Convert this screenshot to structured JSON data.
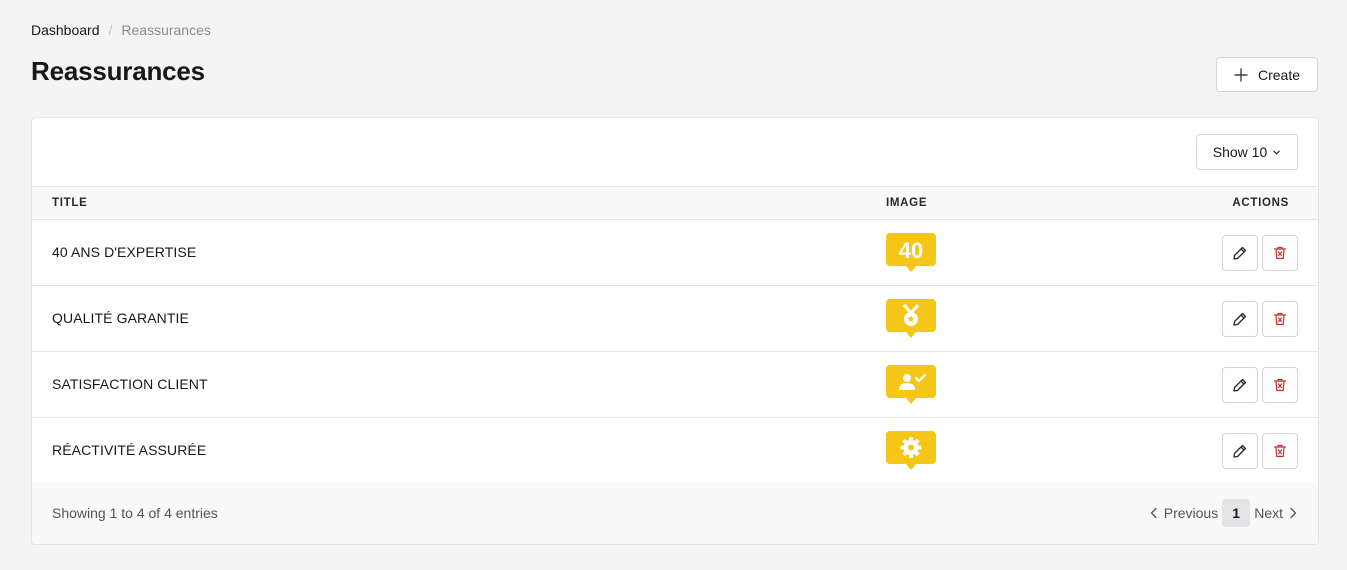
{
  "breadcrumb": {
    "root": "Dashboard",
    "separator": "/",
    "current": "Reassurances"
  },
  "page": {
    "title": "Reassurances"
  },
  "toolbar": {
    "create_label": "Create",
    "show_label": "Show 10"
  },
  "table": {
    "headers": {
      "title": "TITLE",
      "image": "IMAGE",
      "actions": "ACTIONS"
    },
    "rows": [
      {
        "title": "40 ANS D'EXPERTISE",
        "image": "40"
      },
      {
        "title": "QUALITÉ GARANTIE",
        "image": "medal-icon"
      },
      {
        "title": "SATISFACTION CLIENT",
        "image": "user-check-icon"
      },
      {
        "title": "RÉACTIVITÉ ASSURÉE",
        "image": "gear-icon"
      }
    ]
  },
  "footer": {
    "entries": "Showing 1 to 4 of 4 entries",
    "previous": "Previous",
    "page": "1",
    "next": "Next"
  },
  "colors": {
    "badge": "#f5c518",
    "delete": "#c53030",
    "background": "#f4f4f5"
  }
}
